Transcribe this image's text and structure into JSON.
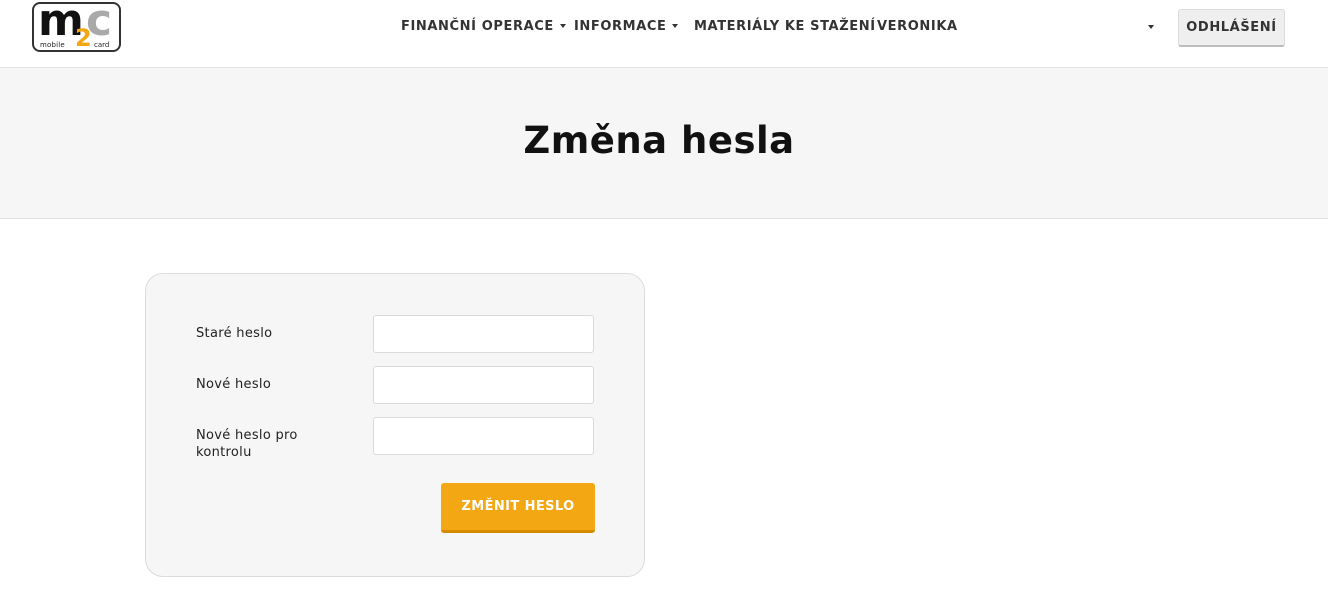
{
  "logo": {
    "main_m": "m",
    "main_c": "c",
    "number": "2",
    "sub_left": "mobile",
    "sub_right": "card"
  },
  "nav": {
    "items": [
      {
        "label": "FINANČNÍ OPERACE",
        "has_dropdown": true
      },
      {
        "label": "INFORMACE",
        "has_dropdown": true
      },
      {
        "label": "MATERIÁLY KE STAŽENÍ",
        "has_dropdown": false
      },
      {
        "label": "VERONIKA",
        "has_dropdown": false
      }
    ],
    "logout_label": "ODHLÁŠENÍ"
  },
  "page": {
    "title": "Změna hesla"
  },
  "form": {
    "fields": [
      {
        "label": "Staré heslo",
        "value": ""
      },
      {
        "label": "Nové heslo",
        "value": ""
      },
      {
        "label": "Nové heslo pro kontrolu",
        "value": ""
      }
    ],
    "submit_label": "ZMĚNIT HESLO"
  },
  "colors": {
    "accent": "#f3a712",
    "hero_bg": "#f6f6f6",
    "panel_bg": "#f6f6f6"
  }
}
